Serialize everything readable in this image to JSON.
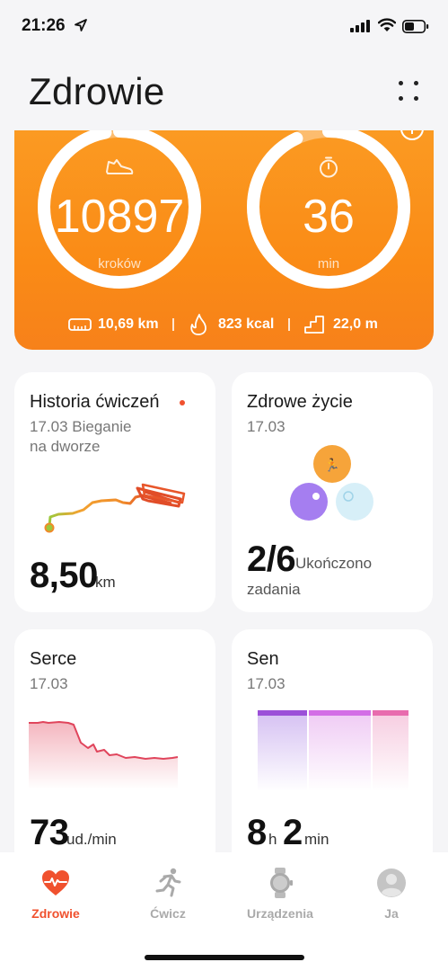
{
  "status_bar": {
    "time": "21:26"
  },
  "header": {
    "title": "Zdrowie"
  },
  "activity": {
    "steps_value": "10897",
    "steps_unit": "kroków",
    "minutes_value": "36",
    "minutes_unit": "min",
    "steps_progress": 0.97,
    "minutes_progress": 0.93,
    "distance": "10,69 km",
    "calories": "823 kcal",
    "floors": "22,0 m"
  },
  "cards": {
    "workout": {
      "title": "Historia ćwiczeń",
      "date_line1": "17.03 Bieganie",
      "date_line2": "na dworze",
      "value": "8,50",
      "unit": "km"
    },
    "healthy": {
      "title": "Zdrowe życie",
      "date": "17.03",
      "value": "2/6",
      "unit_line1": "Ukończono",
      "unit_line2": "zadania"
    },
    "heart": {
      "title": "Serce",
      "date": "17.03",
      "value": "73",
      "unit": "ud./min"
    },
    "sleep": {
      "title": "Sen",
      "date": "17.03",
      "hours": "8",
      "h_unit": "h",
      "minutes": "2",
      "min_unit": "min"
    }
  },
  "tabs": [
    {
      "label": "Zdrowie",
      "active": true,
      "icon": "heart-pulse-icon"
    },
    {
      "label": "Ćwicz",
      "active": false,
      "icon": "runner-icon"
    },
    {
      "label": "Urządzenia",
      "active": false,
      "icon": "watch-icon"
    },
    {
      "label": "Ja",
      "active": false,
      "icon": "profile-icon"
    }
  ],
  "colors": {
    "accent": "#f0512e",
    "orange_card": "#fa8b16",
    "heart_line": "#e0455c",
    "sleep_deep": "#9b4fd8",
    "sleep_light": "#d36ee6",
    "sleep_rem": "#e86cae"
  }
}
